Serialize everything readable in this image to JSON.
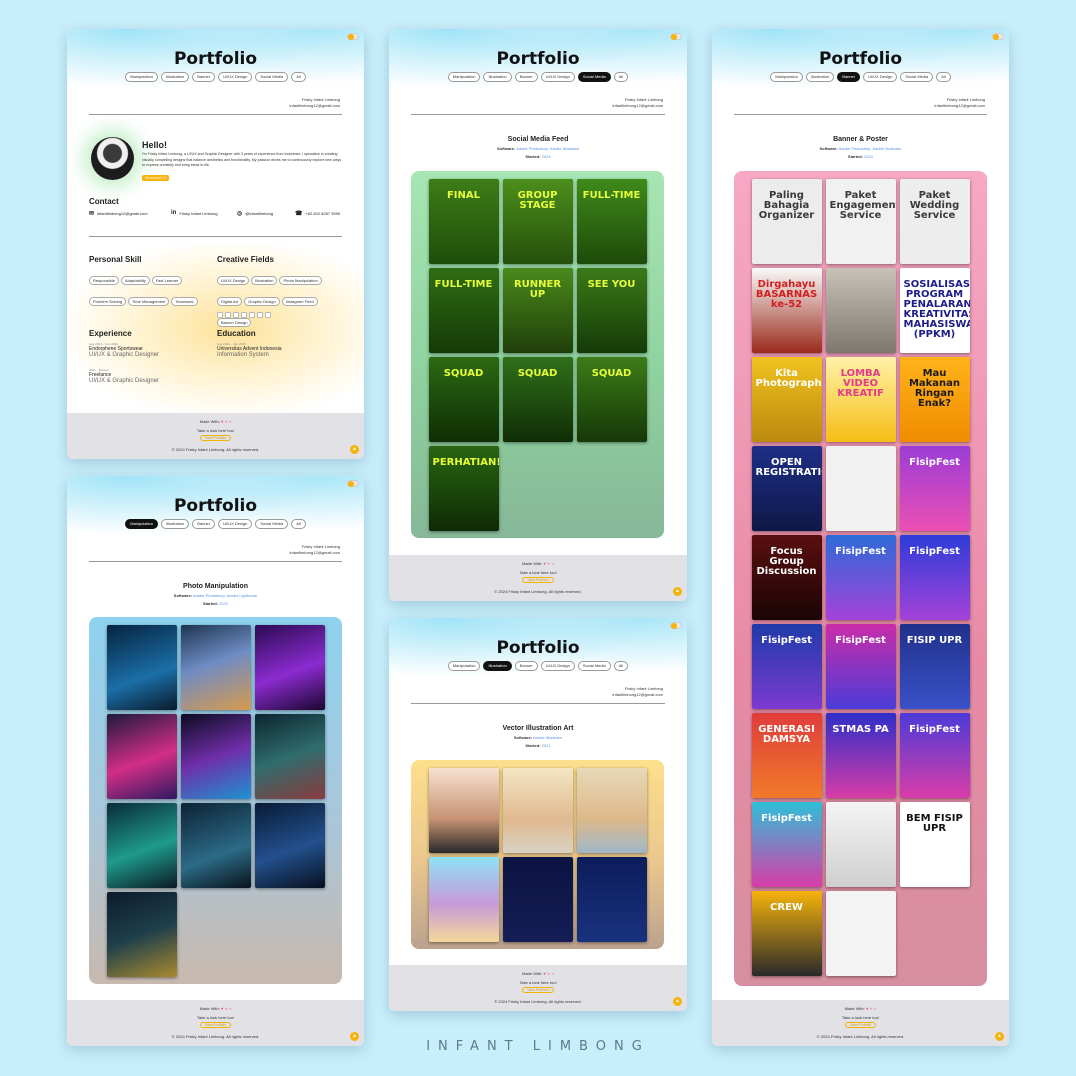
{
  "site_title": "Portfolio",
  "tabs": [
    "Manipulation",
    "Illustration",
    "Banner",
    "UI/UX Design",
    "Social Media",
    "All"
  ],
  "byline": {
    "name": "Frisky Infant Limbong",
    "email": "infantlimbong12@gmail.com"
  },
  "footer": {
    "made_with": "Made With:",
    "look": "Take a look here too!",
    "cta": "View Portfolio",
    "copyright": "© 2024 Frisky Infant Limbong. All rights reserved."
  },
  "about": {
    "greeting": "Hello!",
    "bio": "I'm Frisky Infant Limbong, a UI/UX and Graphic Designer with 3 years of experience from Indonesia. I specialize in creating visually compelling designs that balance aesthetics and functionality. My passion drives me to continuously explore new ways to express creativity and bring ideas to life.",
    "cv_button": "Download CV",
    "contact_title": "Contact",
    "contacts": {
      "email": "infantlimbong12@gmail.com",
      "linkedin": "Frisky Infant Limbong",
      "instagram": "@infantlimbong",
      "phone": "+62 822 8287 3990"
    },
    "skills_title": "Personal Skill",
    "skills": [
      "Responsible",
      "Adaptability",
      "Fast Learner",
      "Problem Solving",
      "Time Management",
      "Teamwork"
    ],
    "fields_title": "Creative Fields",
    "fields": [
      "UI/UX Design",
      "Illustration",
      "Photo Manipulation",
      "Digital Art",
      "Graphic Design",
      "Instagram Feed",
      "Banner Design"
    ],
    "experience_title": "Experience",
    "experience": [
      {
        "period": "Aug 2024 – Nov 2024",
        "org": "Endorphene Sportswear",
        "role": "UI/UX & Graphic Designer"
      },
      {
        "period": "2021 – Recent",
        "org": "Freelance",
        "role": "UI/UX & Graphic Designer"
      }
    ],
    "education_title": "Education",
    "education": [
      {
        "period": "Aug 2021 – Jan 2025",
        "org": "Universitas Advent Indonesia",
        "role": "Information System"
      }
    ]
  },
  "sections": {
    "manipulation": {
      "title": "Photo Manipulation",
      "software_label": "Software:",
      "software": "Adobe Photoshop, Adobe Lightroom",
      "started_label": "Started:",
      "started": "2021"
    },
    "social": {
      "title": "Social Media Feed",
      "software_label": "Software:",
      "software": "Adobe Photoshop, Adobe Illustrator",
      "started_label": "Started:",
      "started": "2024"
    },
    "illustration": {
      "title": "Vector Illustration Art",
      "software_label": "Software:",
      "software": "Adobe Illustrator",
      "started_label": "Started:",
      "started": "2021"
    },
    "banner": {
      "title": "Banner & Poster",
      "software_label": "Software:",
      "software": "Adobe Photoshop, Adobe Illustrator",
      "started_label": "Started:",
      "started": "2021"
    }
  },
  "social_thumbs": [
    "FINAL",
    "GROUP STAGE",
    "FULL-TIME",
    "FULL-TIME",
    "RUNNER UP",
    "SEE YOU",
    "SQUAD",
    "SQUAD",
    "SQUAD",
    "PERHATIAN!"
  ],
  "banner_thumbs": [
    "Paling Bahagia Organizer",
    "Paket Engagement Service",
    "Paket Wedding Service",
    "Dirgahayu BASARNAS ke-52",
    "",
    "SOSIALISASI PROGRAM PENALARAN KREATIVITAS MAHASISWA (PPKM)",
    "Kita Photography",
    "LOMBA VIDEO KREATIF",
    "Mau Makanan Ringan Enak?",
    "OPEN REGISTRATION",
    "",
    "FisipFest",
    "Focus Group Discussion",
    "FisipFest",
    "FisipFest",
    "FisipFest",
    "FisipFest",
    "FISIP UPR",
    "GENERASI DAMSYA",
    "STMAS PA",
    "FisipFest",
    "FisipFest",
    "",
    "BEM FISIP UPR",
    "CREW",
    ""
  ],
  "watermark": "INFANT LIMBONG"
}
